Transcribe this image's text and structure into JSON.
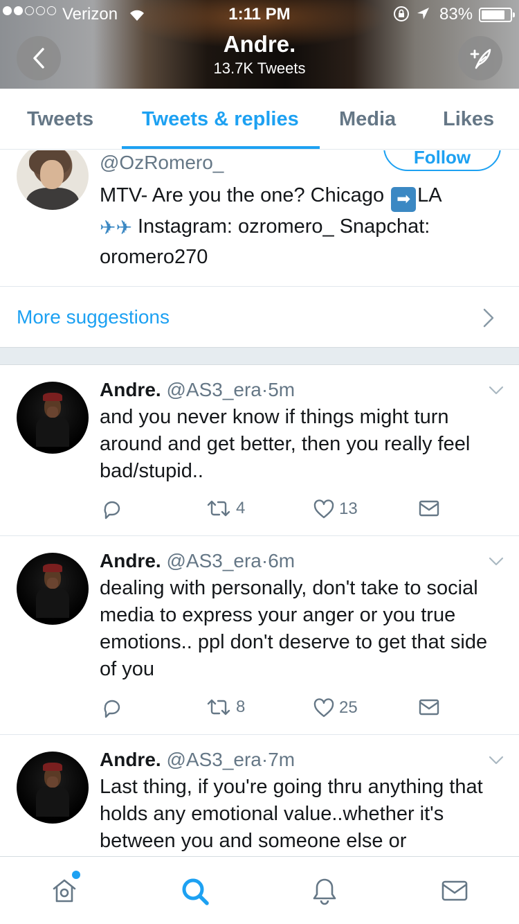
{
  "status_bar": {
    "carrier": "Verizon",
    "time": "1:11 PM",
    "battery": "83%",
    "battery_level": 0.83,
    "signal_bars": 2
  },
  "header": {
    "title": "Andre.",
    "subtitle": "13.7K Tweets"
  },
  "tabs": [
    {
      "label": "Tweets",
      "active": false
    },
    {
      "label": "Tweets & replies",
      "active": true
    },
    {
      "label": "Media",
      "active": false
    },
    {
      "label": "Likes",
      "active": false
    }
  ],
  "suggestion": {
    "handle": "@OzRomero_",
    "follow_label": "Follow",
    "bio_part1": "MTV- Are you the one? Chicago",
    "bio_part2": "LA",
    "bio_part3": "Instagram: ozromero_ Snapchat: oromero270"
  },
  "more_suggestions": "More suggestions",
  "tweets": [
    {
      "name": "Andre.",
      "handle": "@AS3_era",
      "sep": "·",
      "time": "5m",
      "text": "and you never know if things might turn around and get better, then you really feel bad/stupid..",
      "retweets": "4",
      "likes": "13"
    },
    {
      "name": "Andre.",
      "handle": "@AS3_era",
      "sep": "·",
      "time": "6m",
      "text": "dealing with personally, don't take to social media to express your anger or you true emotions.. ppl don't deserve to get that side of you",
      "retweets": "8",
      "likes": "25"
    },
    {
      "name": "Andre.",
      "handle": "@AS3_era",
      "sep": "·",
      "time": "7m",
      "text": "Last thing, if you're going thru anything that holds any emotional value..whether it's between you and someone else or",
      "retweets": "",
      "likes": ""
    }
  ],
  "colors": {
    "accent": "#1da1f2",
    "muted": "#657786",
    "text": "#14171a",
    "divider": "#e1e8ed"
  },
  "icons": {
    "back": "chevron-left-icon",
    "compose": "compose-feather-icon",
    "reply": "reply-icon",
    "retweet": "retweet-icon",
    "like": "heart-icon",
    "dm": "envelope-icon",
    "home": "home-icon",
    "search": "search-icon",
    "notifications": "bell-icon",
    "messages": "envelope-icon"
  }
}
